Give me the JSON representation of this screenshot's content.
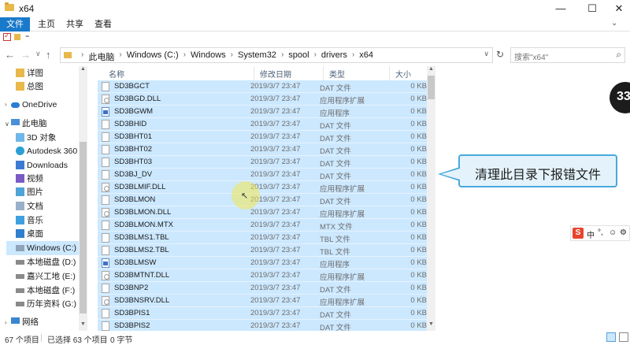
{
  "window": {
    "title": "x64",
    "minimize": "—",
    "maximize": "☐",
    "close": "✕"
  },
  "ribbon": {
    "tabs": [
      "文件",
      "主页",
      "共享",
      "查看"
    ],
    "expand": "⌄"
  },
  "address": {
    "crumbs": [
      "此电脑",
      "Windows (C:)",
      "Windows",
      "System32",
      "spool",
      "drivers",
      "x64"
    ],
    "search_placeholder": "搜索\"x64\""
  },
  "nav_pane": {
    "items": [
      {
        "label": "详图",
        "icon": "folder-icon"
      },
      {
        "label": "总图",
        "icon": "folder-icon"
      },
      {
        "label": "OneDrive",
        "icon": "cloud-icon"
      },
      {
        "label": "此电脑",
        "icon": "computer-icon"
      },
      {
        "label": "3D 对象",
        "icon": "3d-objects-icon"
      },
      {
        "label": "Autodesk 360",
        "icon": "autodesk-icon"
      },
      {
        "label": "Downloads",
        "icon": "download-icon"
      },
      {
        "label": "视频",
        "icon": "video-icon"
      },
      {
        "label": "图片",
        "icon": "picture-icon"
      },
      {
        "label": "文档",
        "icon": "document-icon"
      },
      {
        "label": "音乐",
        "icon": "music-icon"
      },
      {
        "label": "桌面",
        "icon": "desktop-icon"
      },
      {
        "label": "Windows (C:)",
        "icon": "drive-icon",
        "selected": true
      },
      {
        "label": "本地磁盘 (D:)",
        "icon": "drive-icon"
      },
      {
        "label": "嘉兴工地 (E:)",
        "icon": "drive-icon"
      },
      {
        "label": "本地磁盘 (F:)",
        "icon": "drive-icon"
      },
      {
        "label": "历年资料 (G:)",
        "icon": "drive-icon"
      },
      {
        "label": "网络",
        "icon": "network-icon"
      }
    ]
  },
  "columns": {
    "name": "名称",
    "date": "修改日期",
    "type": "类型",
    "size": "大小"
  },
  "files": [
    {
      "name": "SD3BGCT",
      "date": "2019/3/7 23:47",
      "type": "DAT 文件",
      "size": "0 KB",
      "icon": "dat"
    },
    {
      "name": "SD3BGD.DLL",
      "date": "2019/3/7 23:47",
      "type": "应用程序扩展",
      "size": "0 KB",
      "icon": "dll"
    },
    {
      "name": "SD3BGWM",
      "date": "2019/3/7 23:47",
      "type": "应用程序",
      "size": "0 KB",
      "icon": "exe"
    },
    {
      "name": "SD3BHID",
      "date": "2019/3/7 23:47",
      "type": "DAT 文件",
      "size": "0 KB",
      "icon": "dat"
    },
    {
      "name": "SD3BHT01",
      "date": "2019/3/7 23:47",
      "type": "DAT 文件",
      "size": "0 KB",
      "icon": "dat"
    },
    {
      "name": "SD3BHT02",
      "date": "2019/3/7 23:47",
      "type": "DAT 文件",
      "size": "0 KB",
      "icon": "dat"
    },
    {
      "name": "SD3BHT03",
      "date": "2019/3/7 23:47",
      "type": "DAT 文件",
      "size": "0 KB",
      "icon": "dat"
    },
    {
      "name": "SD3BJ_DV",
      "date": "2019/3/7 23:47",
      "type": "DAT 文件",
      "size": "0 KB",
      "icon": "dat"
    },
    {
      "name": "SD3BLMIF.DLL",
      "date": "2019/3/7 23:47",
      "type": "应用程序扩展",
      "size": "0 KB",
      "icon": "dll"
    },
    {
      "name": "SD3BLMON",
      "date": "2019/3/7 23:47",
      "type": "DAT 文件",
      "size": "0 KB",
      "icon": "dat"
    },
    {
      "name": "SD3BLMON.DLL",
      "date": "2019/3/7 23:47",
      "type": "应用程序扩展",
      "size": "0 KB",
      "icon": "dll"
    },
    {
      "name": "SD3BLMON.MTX",
      "date": "2019/3/7 23:47",
      "type": "MTX 文件",
      "size": "0 KB",
      "icon": "dat"
    },
    {
      "name": "SD3BLMS1.TBL",
      "date": "2019/3/7 23:47",
      "type": "TBL 文件",
      "size": "0 KB",
      "icon": "dat"
    },
    {
      "name": "SD3BLMS2.TBL",
      "date": "2019/3/7 23:47",
      "type": "TBL 文件",
      "size": "0 KB",
      "icon": "dat"
    },
    {
      "name": "SD3BLMSW",
      "date": "2019/3/7 23:47",
      "type": "应用程序",
      "size": "0 KB",
      "icon": "exe"
    },
    {
      "name": "SD3BMTNT.DLL",
      "date": "2019/3/7 23:47",
      "type": "应用程序扩展",
      "size": "0 KB",
      "icon": "dll"
    },
    {
      "name": "SD3BNP2",
      "date": "2019/3/7 23:47",
      "type": "DAT 文件",
      "size": "0 KB",
      "icon": "dat"
    },
    {
      "name": "SD3BNSRV.DLL",
      "date": "2019/3/7 23:47",
      "type": "应用程序扩展",
      "size": "0 KB",
      "icon": "dll"
    },
    {
      "name": "SD3BPIS1",
      "date": "2019/3/7 23:47",
      "type": "DAT 文件",
      "size": "0 KB",
      "icon": "dat"
    },
    {
      "name": "SD3BPIS2",
      "date": "2019/3/7 23:47",
      "type": "DAT 文件",
      "size": "0 KB",
      "icon": "dat"
    }
  ],
  "callout": {
    "text": "清理此目录下报错文件"
  },
  "badge": {
    "text": "33"
  },
  "ime": {
    "logo": "S",
    "mode": "中",
    "punct": "°,",
    "emoji": "☺",
    "more": "⚙"
  },
  "status": {
    "count": "67 个项目",
    "selected": "已选择 63 个项目",
    "size": "0 字节"
  },
  "colors": {
    "selection": "#cce8ff",
    "file_tab": "#1979ca",
    "callout_border": "#49a8de"
  }
}
